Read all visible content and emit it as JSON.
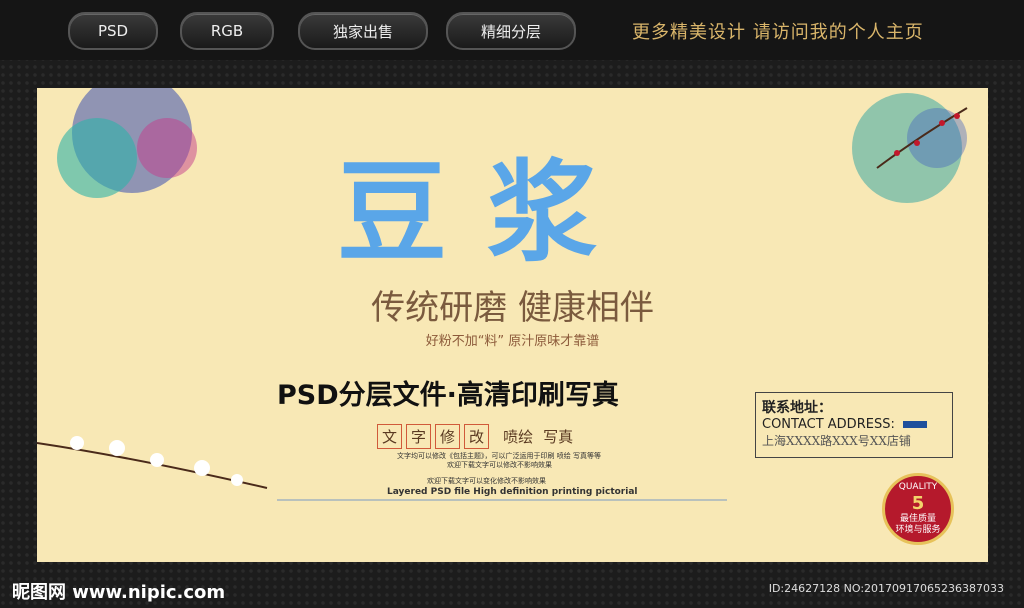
{
  "tabs": [
    "PSD",
    "RGB",
    "独家出售",
    "精细分层"
  ],
  "top_right": "更多精美设计  请访问我的个人主页",
  "poster": {
    "title": "豆浆",
    "slogan": "传统研磨 健康相伴",
    "subslogan": "好粉不加“料”  原汁原味才靠谱",
    "psd_line": "PSD分层文件·高清印刷写真",
    "boxes": [
      "文",
      "字",
      "修",
      "改"
    ],
    "extras": [
      "喷绘",
      "写真"
    ],
    "note1": "文字均可以修改《包括主题》，可以广泛运用于印刷 喷绘 写真等等",
    "note2": "欢迎下载文字可以修改不影响效果",
    "note3": "欢迎下载文字可以变化修改不影响效果",
    "english": "Layered PSD file High definition printing pictorial",
    "contact_title": "联系地址：",
    "contact_en": "CONTACT ADDRESS:",
    "contact_addr": "上海XXXX路XXX号XX店铺",
    "badge_top": "QUALITY",
    "badge_num": "5",
    "badge_line1": "最佳质量",
    "badge_line2": "环境与服务"
  },
  "watermark": "昵图网 www.nipic.com",
  "id_line": "ID:24627128 NO:20170917065236387033"
}
